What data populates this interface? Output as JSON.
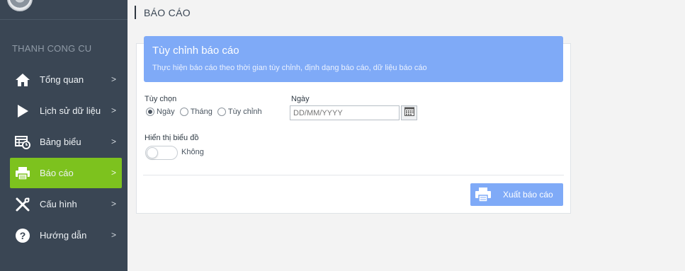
{
  "sidebar": {
    "user_name": "",
    "section_title": "THANH CONG CU",
    "items": [
      {
        "label": "Tổng quan",
        "icon": "home-icon",
        "chevron": ">"
      },
      {
        "label": "Lịch sử dữ liệu",
        "icon": "play-icon",
        "chevron": ">"
      },
      {
        "label": "Bảng biểu",
        "icon": "table-icon",
        "chevron": ">"
      },
      {
        "label": "Báo cáo",
        "icon": "printer-icon",
        "chevron": ">",
        "active": true
      },
      {
        "label": "Cấu hình",
        "icon": "tools-icon",
        "chevron": ">"
      },
      {
        "label": "Hướng dẫn",
        "icon": "help-icon",
        "chevron": ">"
      }
    ]
  },
  "header": {
    "title": "BÁO CÁO"
  },
  "banner": {
    "title": "Tùy chỉnh báo cáo",
    "subtitle": "Thực hiện báo cáo theo thời gian tùy chỉnh, định dạng báo cáo, dữ liệu báo cáo"
  },
  "form": {
    "option_label": "Tùy chọn",
    "options": [
      {
        "label": "Ngày",
        "checked": true
      },
      {
        "label": "Tháng",
        "checked": false
      },
      {
        "label": "Tùy chỉnh",
        "checked": false
      }
    ],
    "date_label": "Ngày",
    "date_placeholder": "DD/MM/YYYY",
    "date_value": "",
    "chart_label": "Hiển thị biểu đồ",
    "chart_toggle_text": "Không",
    "chart_toggle_on": false
  },
  "actions": {
    "export_label": "Xuất báo cáo"
  },
  "colors": {
    "sidebar": "#3a4654",
    "active": "#7dc21e",
    "accent": "#7faaf7",
    "background": "#f3f3f3"
  }
}
